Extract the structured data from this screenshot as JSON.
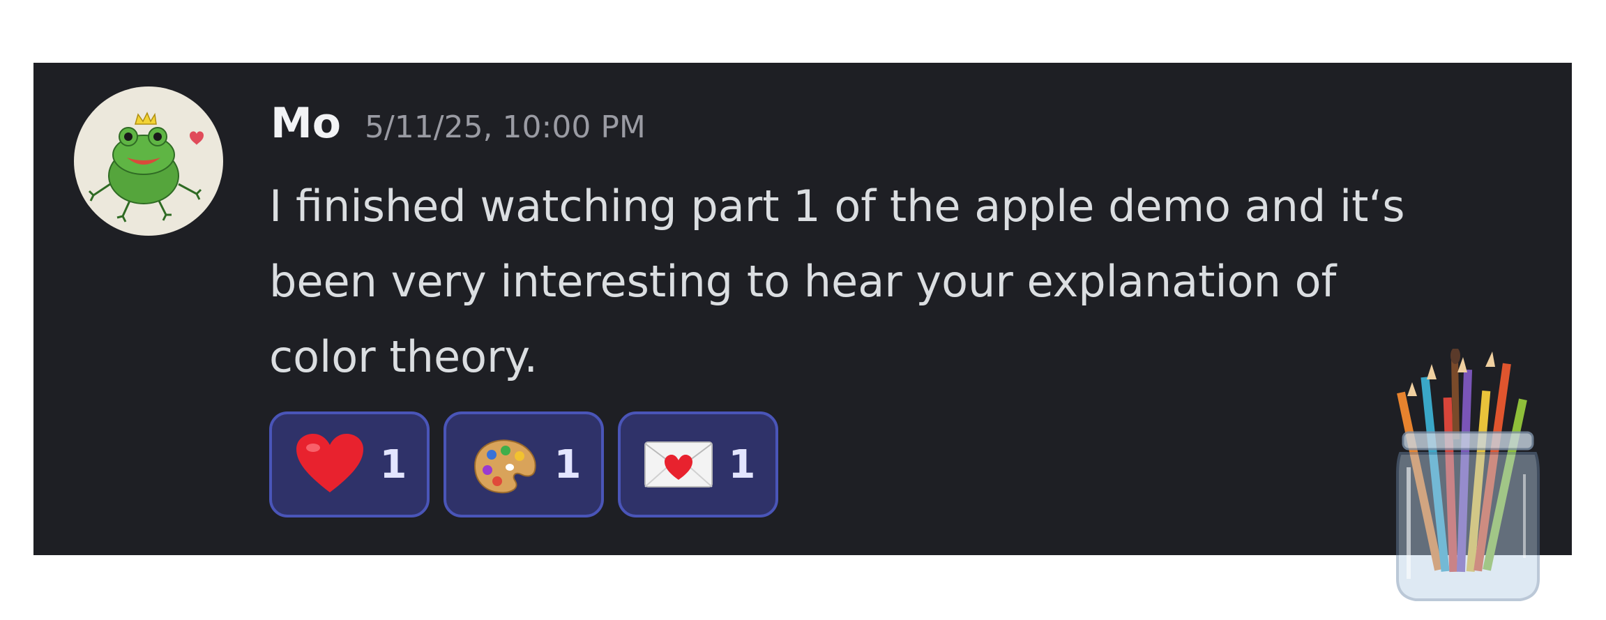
{
  "message": {
    "username": "Mo",
    "timestamp": "5/11/25, 10:00 PM",
    "body_lines": [
      "I finished watching part 1 of the apple demo and it‘s",
      "been very interesting to hear your explanation of",
      "color theory."
    ]
  },
  "reactions": [
    {
      "emoji": "red-heart-icon",
      "count": "1"
    },
    {
      "emoji": "artist-palette-icon",
      "count": "1"
    },
    {
      "emoji": "love-letter-icon",
      "count": "1"
    }
  ],
  "avatar": {
    "icon": "frog-prince-icon"
  },
  "sticker": {
    "icon": "pencil-jar-icon"
  },
  "colors": {
    "card_bg": "#1e1f24",
    "reaction_bg": "#2f3269",
    "reaction_border": "#4a55b8",
    "username": "#f2f3f5",
    "timestamp": "#9a9ba3",
    "body_text": "#dbdee1"
  }
}
